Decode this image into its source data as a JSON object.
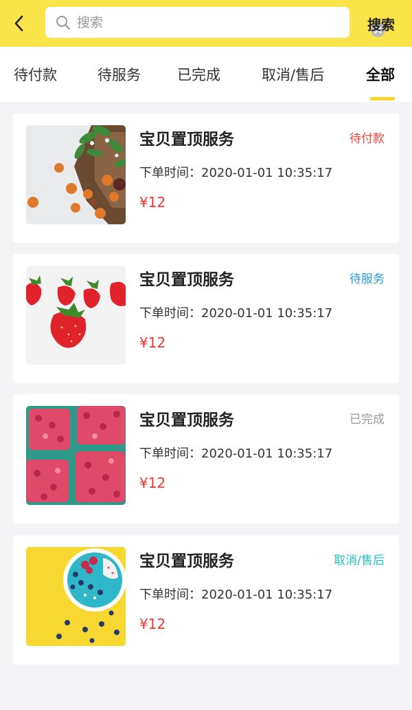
{
  "header": {
    "back_icon": "chevron-left-icon",
    "search": {
      "placeholder": "搜索",
      "value": "",
      "search_icon": "search-icon",
      "clear_icon": "clear-icon"
    },
    "search_button_label": "搜索"
  },
  "tabs": [
    {
      "label": "待付款",
      "active": false
    },
    {
      "label": "待服务",
      "active": false
    },
    {
      "label": "已完成",
      "active": false
    },
    {
      "label": "取消/售后",
      "active": false
    },
    {
      "label": "全部",
      "active": true
    }
  ],
  "orders": [
    {
      "title": "宝贝置顶服务",
      "status": "待付款",
      "status_color": "#f0443a",
      "time": "下单时间：2020-01-01 10:35:17",
      "price": "¥12",
      "image": "apricots-on-cutting-board"
    },
    {
      "title": "宝贝置顶服务",
      "status": "待服务",
      "status_color": "#2a9ad8",
      "time": "下单时间：2020-01-01 10:35:17",
      "price": "¥12",
      "image": "strawberries"
    },
    {
      "title": "宝贝置顶服务",
      "status": "已完成",
      "status_color": "#999999",
      "time": "下单时间：2020-01-01 10:35:17",
      "price": "¥12",
      "image": "raspberries-in-baskets"
    },
    {
      "title": "宝贝置顶服务",
      "status": "取消/售后",
      "status_color": "#22c1c1",
      "time": "下单时间：2020-01-01 10:35:17",
      "price": "¥12",
      "image": "smoothie-bowl"
    }
  ],
  "colors": {
    "header_bg": "#fbe34a",
    "price": "#f0352e",
    "tab_indicator": "#fbd52a",
    "page_bg": "#f4f4f6"
  }
}
